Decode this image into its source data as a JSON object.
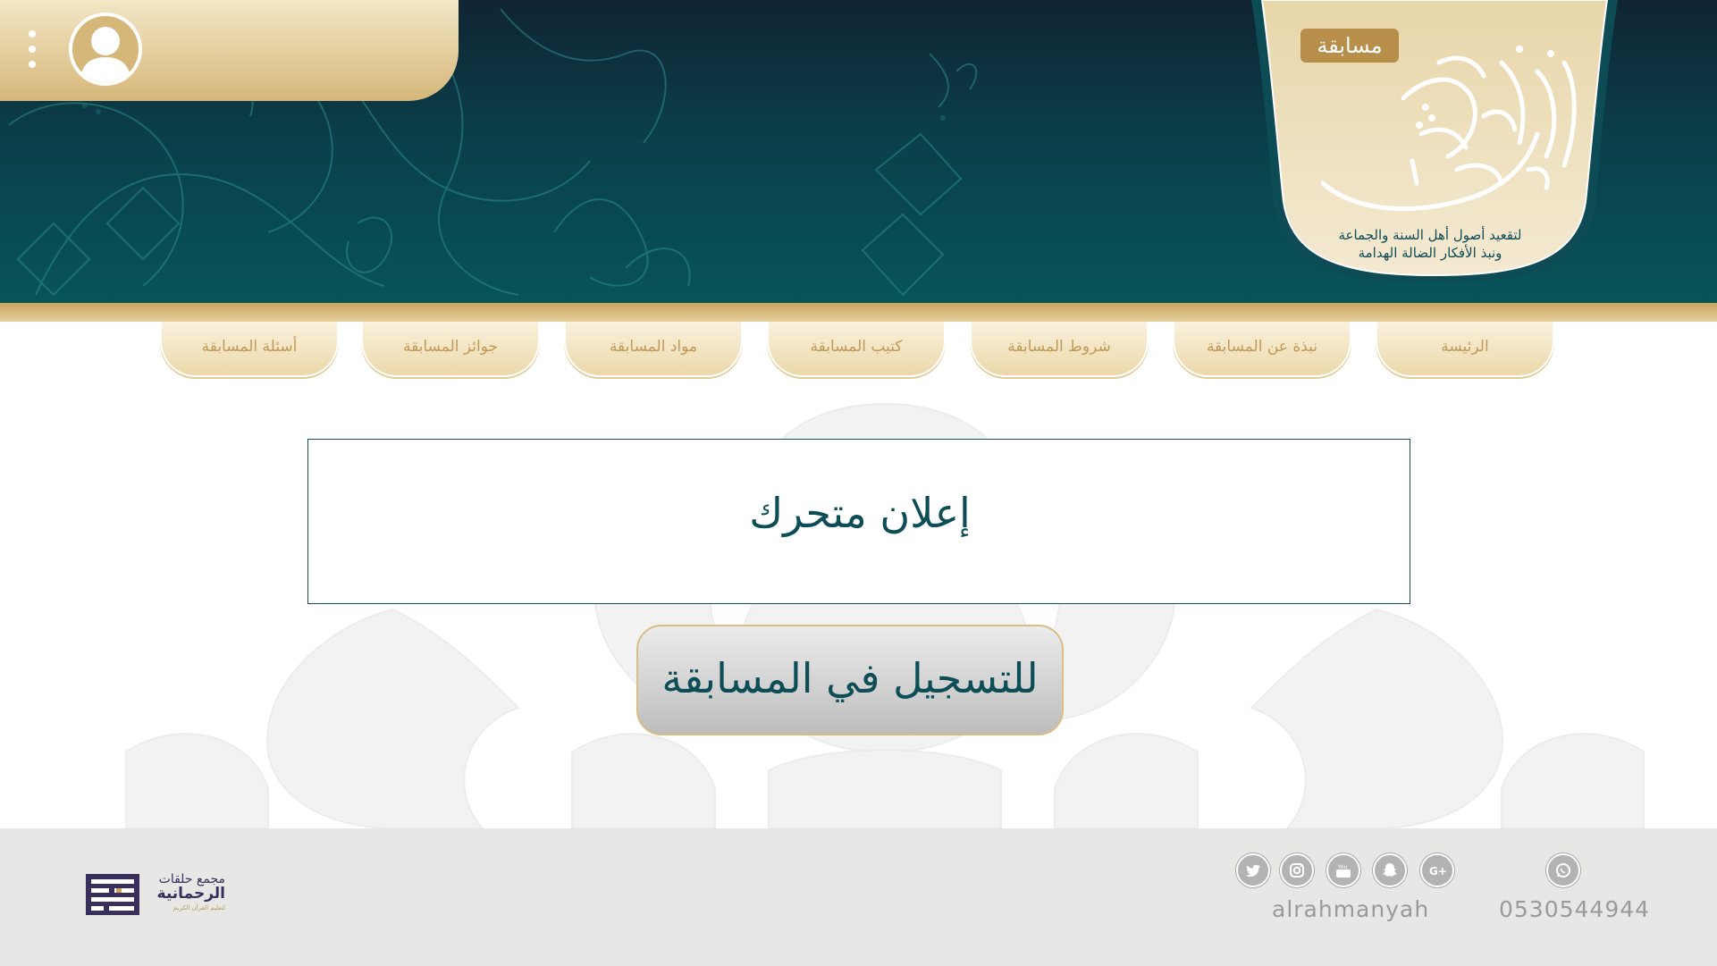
{
  "header": {
    "badge": "مسابقة",
    "tagline_line1": "لتقعيد أصول أهل السنة والجماعة",
    "tagline_line2": "ونبذ الأفكار الضالة الهدامة",
    "colors": {
      "teal": "#075459",
      "navy": "#102432",
      "gold": "#c9a45f"
    }
  },
  "user_bar": {
    "avatar_icon": "user-avatar-icon",
    "menu_icon": "kebab-menu-icon"
  },
  "nav": {
    "items": [
      {
        "label": "الرئيسة"
      },
      {
        "label": "نبذة عن المسابقة"
      },
      {
        "label": "شروط المسابقة"
      },
      {
        "label": "كتيب المسابقة"
      },
      {
        "label": "مواد المسابقة"
      },
      {
        "label": "جوائز المسابقة"
      },
      {
        "label": "أسئلة المسابقة"
      }
    ]
  },
  "main": {
    "ad_text": "إعلان متحرك",
    "register_label": "للتسجيل في المسابقة"
  },
  "footer": {
    "whatsapp_number": "0530544944",
    "social_handle": "alrahmanyah",
    "social_icons": [
      "google-plus-icon",
      "snapchat-icon",
      "youtube-icon",
      "instagram-icon",
      "twitter-icon"
    ],
    "whatsapp_icon": "whatsapp-icon",
    "org_name_line1": "مجمع حلقات",
    "org_name_line2": "الرحمانية",
    "org_sub": "لتعليم القرآن الكريم"
  }
}
